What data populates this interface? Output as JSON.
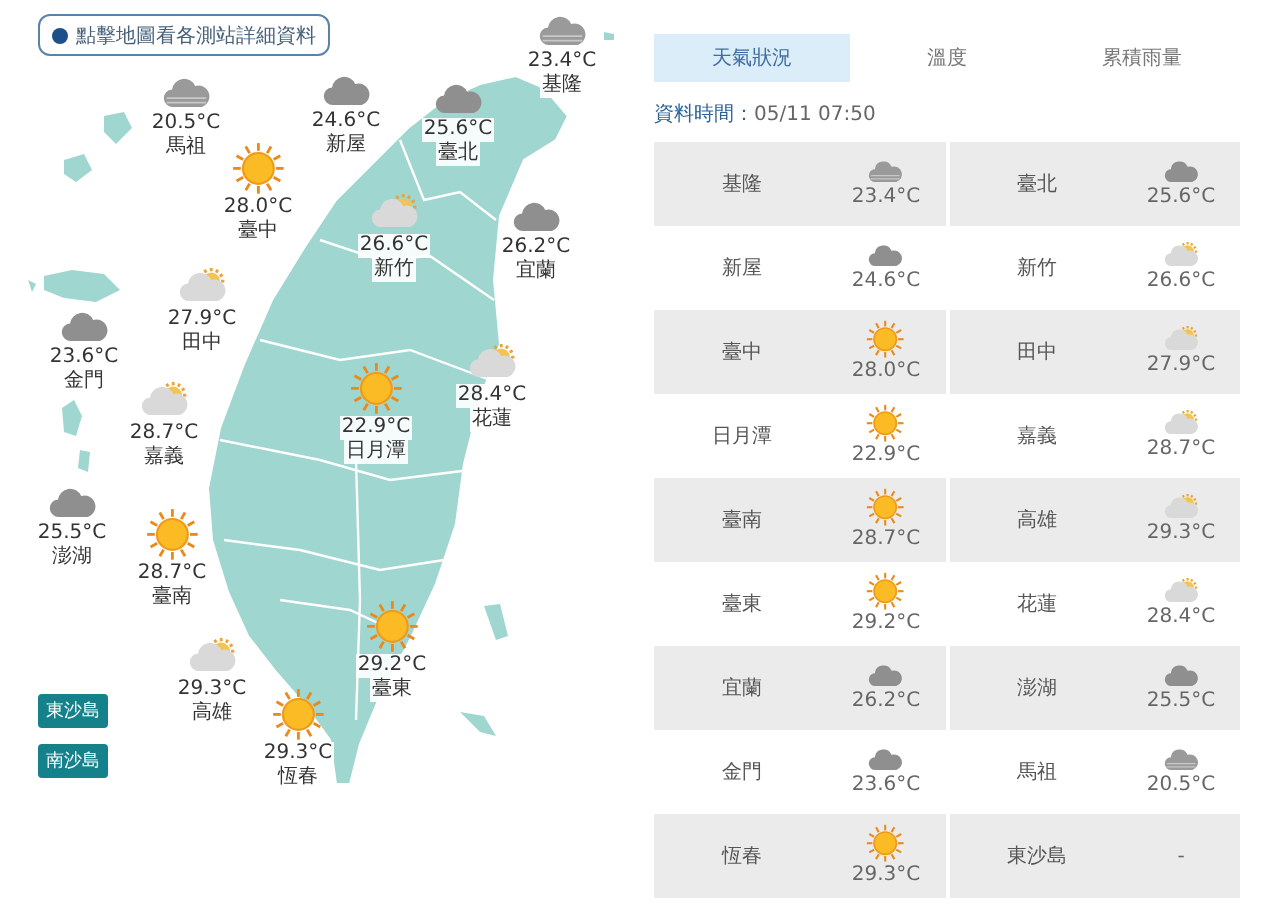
{
  "map": {
    "hint": "點擊地圖看各測站詳細資料",
    "stations": [
      {
        "name": "基隆",
        "temp": "23.4°C",
        "kind": "overcast"
      },
      {
        "name": "馬祖",
        "temp": "20.5°C",
        "kind": "overcast"
      },
      {
        "name": "新屋",
        "temp": "24.6°C",
        "kind": "cloudy"
      },
      {
        "name": "臺北",
        "temp": "25.6°C",
        "kind": "cloudy"
      },
      {
        "name": "臺中",
        "temp": "28.0°C",
        "kind": "sunny"
      },
      {
        "name": "新竹",
        "temp": "26.6°C",
        "kind": "partly"
      },
      {
        "name": "宜蘭",
        "temp": "26.2°C",
        "kind": "cloudy"
      },
      {
        "name": "田中",
        "temp": "27.9°C",
        "kind": "partly"
      },
      {
        "name": "金門",
        "temp": "23.6°C",
        "kind": "cloudy"
      },
      {
        "name": "日月潭",
        "temp": "22.9°C",
        "kind": "sunny"
      },
      {
        "name": "花蓮",
        "temp": "28.4°C",
        "kind": "partly"
      },
      {
        "name": "嘉義",
        "temp": "28.7°C",
        "kind": "partly"
      },
      {
        "name": "澎湖",
        "temp": "25.5°C",
        "kind": "cloudy"
      },
      {
        "name": "臺南",
        "temp": "28.7°C",
        "kind": "sunny"
      },
      {
        "name": "臺東",
        "temp": "29.2°C",
        "kind": "sunny"
      },
      {
        "name": "高雄",
        "temp": "29.3°C",
        "kind": "partly"
      },
      {
        "name": "恆春",
        "temp": "29.3°C",
        "kind": "sunny"
      }
    ],
    "island_buttons": [
      "東沙島",
      "南沙島"
    ]
  },
  "tabs": [
    {
      "label": "天氣狀況",
      "selected": true
    },
    {
      "label": "溫度",
      "selected": false
    },
    {
      "label": "累積雨量",
      "selected": false
    }
  ],
  "time_label": "資料時間：",
  "time": "05/11 07:50",
  "table_rows": [
    [
      {
        "name": "基隆",
        "temp": "23.4°C",
        "kind": "overcast"
      },
      {
        "name": "臺北",
        "temp": "25.6°C",
        "kind": "cloudy"
      }
    ],
    [
      {
        "name": "新屋",
        "temp": "24.6°C",
        "kind": "cloudy"
      },
      {
        "name": "新竹",
        "temp": "26.6°C",
        "kind": "partly"
      }
    ],
    [
      {
        "name": "臺中",
        "temp": "28.0°C",
        "kind": "sunny"
      },
      {
        "name": "田中",
        "temp": "27.9°C",
        "kind": "partly"
      }
    ],
    [
      {
        "name": "日月潭",
        "temp": "22.9°C",
        "kind": "sunny"
      },
      {
        "name": "嘉義",
        "temp": "28.7°C",
        "kind": "partly"
      }
    ],
    [
      {
        "name": "臺南",
        "temp": "28.7°C",
        "kind": "sunny"
      },
      {
        "name": "高雄",
        "temp": "29.3°C",
        "kind": "partly"
      }
    ],
    [
      {
        "name": "臺東",
        "temp": "29.2°C",
        "kind": "sunny"
      },
      {
        "name": "花蓮",
        "temp": "28.4°C",
        "kind": "partly"
      }
    ],
    [
      {
        "name": "宜蘭",
        "temp": "26.2°C",
        "kind": "cloudy"
      },
      {
        "name": "澎湖",
        "temp": "25.5°C",
        "kind": "cloudy"
      }
    ],
    [
      {
        "name": "金門",
        "temp": "23.6°C",
        "kind": "cloudy"
      },
      {
        "name": "馬祖",
        "temp": "20.5°C",
        "kind": "overcast"
      }
    ],
    [
      {
        "name": "恆春",
        "temp": "29.3°C",
        "kind": "sunny"
      },
      {
        "name": "東沙島",
        "temp": "-"
      }
    ]
  ]
}
